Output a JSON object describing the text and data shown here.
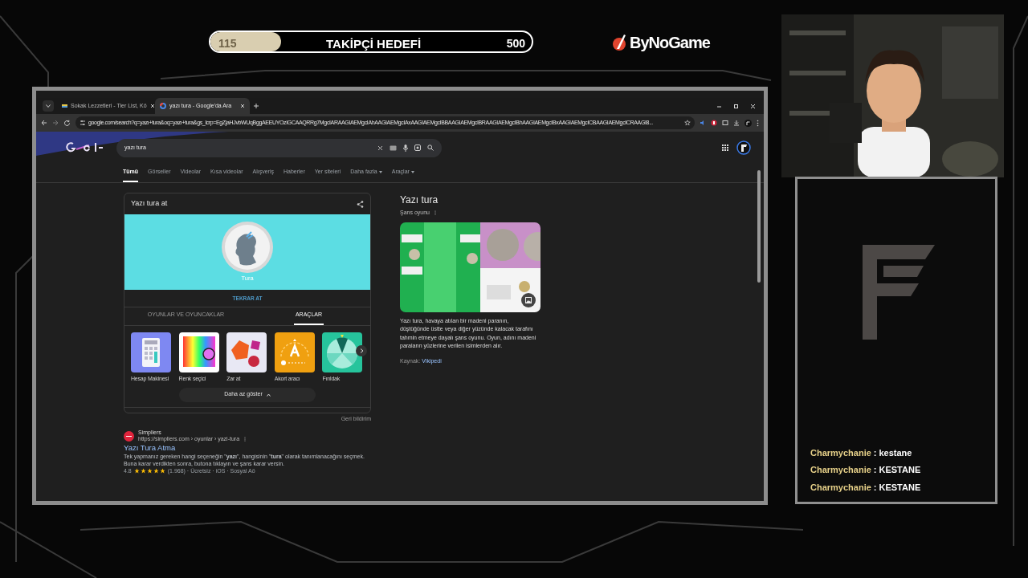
{
  "goal": {
    "current": "115",
    "title": "TAKİPÇİ HEDEFİ",
    "target": "500",
    "level": 0.22
  },
  "brand": {
    "name": "ByNoGame"
  },
  "browser": {
    "tabs": [
      {
        "title": "Sokak Lezzetleri - Tier List, Kö",
        "selected": false
      },
      {
        "title": "yazı tura - Google'da Ara",
        "selected": true
      }
    ],
    "url": "google.com/search?q=yazı+tura&oq=yazı+tura&gs_lcrp=EgZjaHJvbWUqBggAEEUYOzIGCAAQRRg7MgcIARAAGIAEMgcIAhAAGIAEMgcIAxAAGIAEMgcIBBAAGIAEMgcIBRAAGIAEMgcIBhAAGIAEMgcIBxAAGIAEMgcICBAAGIAEMgcICRAAGI8...",
    "search": {
      "value": "yazı tura"
    },
    "nav_tabs": [
      {
        "label": "Tümü",
        "selected": true
      },
      {
        "label": "Görseller",
        "selected": false
      },
      {
        "label": "Videolar",
        "selected": false
      },
      {
        "label": "Kısa videolar",
        "selected": false
      },
      {
        "label": "Alışveriş",
        "selected": false
      },
      {
        "label": "Haberler",
        "selected": false
      },
      {
        "label": "Yer siteleri",
        "selected": false
      },
      {
        "label": "Daha fazla",
        "selected": false,
        "dropdown": true
      },
      {
        "label": "Araçlar",
        "selected": false,
        "dropdown": true
      }
    ],
    "coin_card": {
      "title": "Yazı tura at",
      "result": "Tura",
      "button": "TEKRAR AT",
      "tabs": [
        {
          "label": "OYUNLAR VE OYUNCAKLAR",
          "selected": false
        },
        {
          "label": "ARAÇLAR",
          "selected": true
        }
      ],
      "tools": [
        {
          "label": "Hesap Makinesi"
        },
        {
          "label": "Renk seçici"
        },
        {
          "label": "Zar at"
        },
        {
          "label": "Akort aracı"
        },
        {
          "label": "Fırıldak"
        }
      ],
      "show_less": "Daha az göster",
      "feedback": "Geri bildirim"
    },
    "knowledge": {
      "title": "Yazı tura",
      "subtitle": "Şans oyunu",
      "description": "Yazı tura, havaya atılan bir madeni paranın, düştüğünde üstte veya diğer yüzünde kalacak tarafını tahmin etmeye dayalı şans oyunu. Oyun, adını madeni paraların yüzlerine verilen isimlerden alır.",
      "source_label": "Kaynak:",
      "source_link": "Vikipedi"
    },
    "result": {
      "site": "Simpliers",
      "url": "https://simpliers.com › oyunlar › yazi-tura",
      "title": "Yazı Tura Atma",
      "snippet": "Tek yapmanız gereken hangi seçeneğin \"**yazı**\", hangisinin \"**tura**\" olarak tanımlanacağını seçmek. Buna karar verdikten sonra, butona tıklayın ve şans karar versin.",
      "rating": "4.8",
      "stars": 5,
      "meta": "(1.968) · Ücretsiz · iOS · Sosyal Aö"
    }
  },
  "chat": [
    {
      "user": "Charmychanie",
      "separator": ":",
      "message": "kestane"
    },
    {
      "user": "Charmychanie",
      "separator": ":",
      "message": "KESTANE"
    },
    {
      "user": "Charmychanie",
      "separator": ":",
      "message": "KESTANE"
    }
  ]
}
